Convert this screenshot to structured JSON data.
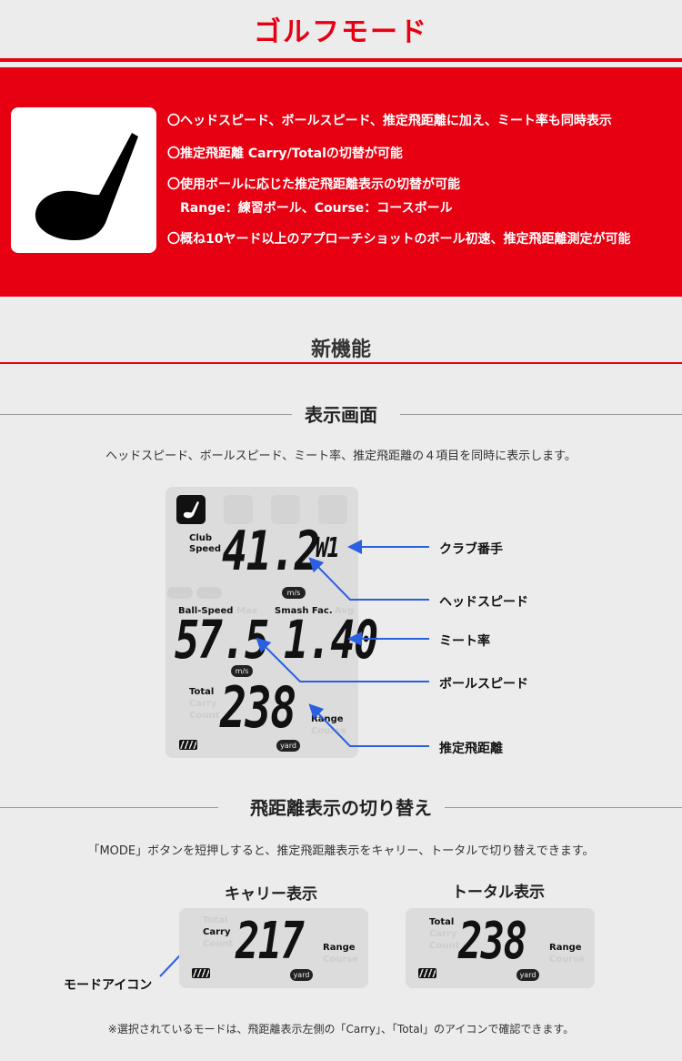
{
  "header": {
    "title": "ゴルフモード",
    "accent_color": "#e60012"
  },
  "mode_icon": "golf-club-icon",
  "features": [
    "〇ヘッドスピード、ボールスピード、推定飛距離に加え、ミート率も同時表示",
    "〇推定飛距離 Carry/Totalの切替が可能",
    "〇使用ボールに応じた推定飛距離表示の切替が可能",
    "Range：練習ボール、Course：コースボール",
    "〇概ね10ヤード以上のアプローチショットのボール初速、推定飛距離測定が可能"
  ],
  "new_features": {
    "heading": "新機能"
  },
  "display_screen": {
    "heading": "表示画面",
    "description": "ヘッドスピード、ボールスピード、ミート率、推定飛距離の４項目を同時に表示します。",
    "lcd": {
      "club_speed_label_1": "Club",
      "club_speed_label_2": "Speed",
      "club_speed_value": "41.2",
      "club_number": "W1",
      "unit_ms": "m/s",
      "ball_speed_label": "Ball-Speed",
      "max_label": "Max",
      "smash_label": "Smash Fac.",
      "avg_label": "Avg",
      "ball_speed_value": "57.5",
      "smash_value": "1.40",
      "total_label": "Total",
      "carry_label": "Carry",
      "count_label": "Count",
      "distance_value": "238",
      "range_label": "Range",
      "course_label": "Course",
      "unit_yard": "yard"
    },
    "callouts": [
      "クラブ番手",
      "ヘッドスピード",
      "ミート率",
      "ボールスピード",
      "推定飛距離"
    ]
  },
  "distance_switch": {
    "heading": "飛距離表示の切り替え",
    "description": "「MODE」ボタンを短押しすると、推定飛距離表示をキャリー、トータルで切り替えできます。",
    "carry_panel": {
      "title": "キャリー表示",
      "total_label": "Total",
      "carry_label": "Carry",
      "count_label": "Count",
      "value": "217",
      "range_label": "Range",
      "course_label": "Course",
      "unit": "yard"
    },
    "total_panel": {
      "title": "トータル表示",
      "total_label": "Total",
      "carry_label": "Carry",
      "count_label": "Count",
      "value": "238",
      "range_label": "Range",
      "course_label": "Course",
      "unit": "yard"
    },
    "mode_icon_callout": "モードアイコン",
    "note": "※選択されているモードは、飛距離表示左側の「Carry」、「Total」のアイコンで確認できます。"
  }
}
